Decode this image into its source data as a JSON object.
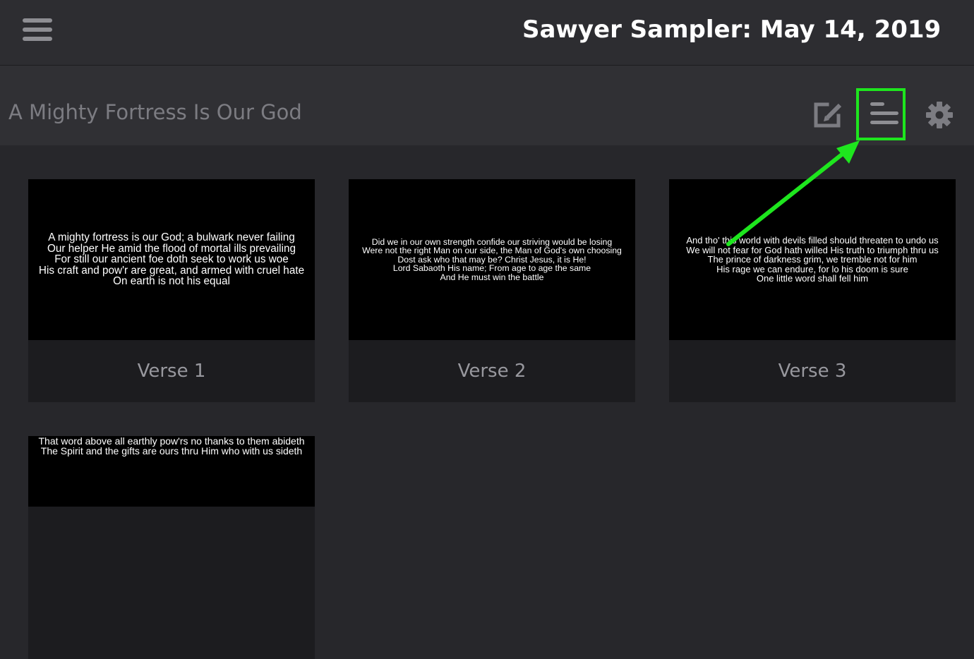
{
  "header": {
    "title": "Sawyer Sampler: May 14, 2019",
    "menu_icon": "hamburger-menu-icon"
  },
  "song": {
    "title": "A Mighty Fortress Is Our God",
    "tools": [
      {
        "name": "edit-icon"
      },
      {
        "name": "arrangement-icon",
        "highlighted": true
      },
      {
        "name": "gear-icon"
      }
    ]
  },
  "annotation": {
    "color": "#1ee61e",
    "type": "highlight-box-with-arrow"
  },
  "slides": [
    {
      "label": "Verse 1",
      "lyrics": "A mighty fortress is our God; a bulwark never failing\nOur helper He amid the flood of mortal ills prevailing\nFor still our ancient foe doth seek to work us woe\nHis craft and pow'r are great, and armed with cruel hate\nOn earth is not his equal"
    },
    {
      "label": "Verse 2",
      "lyrics": "Did we in our own strength confide our striving would be losing\nWere not the right Man on our side, the Man of God's own choosing\nDost ask who that may be? Christ Jesus, it is He!\nLord Sabaoth His name; From age to age the same\nAnd He must win the battle"
    },
    {
      "label": "Verse 3",
      "lyrics": "And tho' this world with devils filled should threaten to undo us\nWe will not fear for God hath willed His truth to triumph thru us\nThe prince of darkness grim, we tremble not for him\nHis rage we can endure, for lo his doom is sure\nOne little word shall fell him"
    },
    {
      "label": "",
      "lyrics": "That word above all earthly pow'rs no thanks to them abideth\nThe Spirit and the gifts are ours thru Him who with us sideth"
    }
  ]
}
